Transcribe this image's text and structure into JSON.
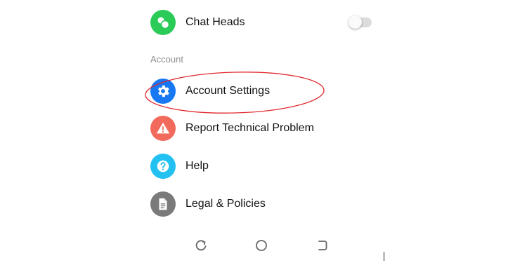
{
  "settings": {
    "chat_heads": {
      "label": "Chat Heads",
      "icon": "chat-heads-icon",
      "color": "#2bcb58",
      "toggle_on": false
    },
    "account_section_header": "Account",
    "items": [
      {
        "label": "Account Settings",
        "icon": "gear-icon",
        "color": "#1877f2"
      },
      {
        "label": "Report Technical Problem",
        "icon": "warning-icon",
        "color": "#f26a5b"
      },
      {
        "label": "Help",
        "icon": "question-icon",
        "color": "#22c1f2"
      },
      {
        "label": "Legal & Policies",
        "icon": "document-icon",
        "color": "#7a7a7a"
      }
    ]
  },
  "annotation": {
    "shape": "ellipse",
    "color": "#e0282c",
    "target": "Account Settings"
  },
  "navbar": {
    "buttons": [
      "recent-apps-icon",
      "home-icon",
      "back-icon"
    ]
  }
}
